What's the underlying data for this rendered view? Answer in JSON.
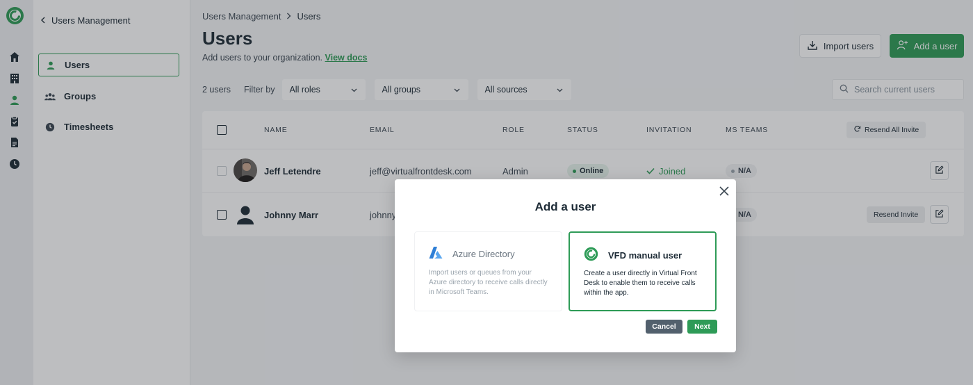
{
  "sidebar": {
    "back_label": "Users Management",
    "items": [
      {
        "label": "Users",
        "icon": "person-icon"
      },
      {
        "label": "Groups",
        "icon": "groups-icon"
      },
      {
        "label": "Timesheets",
        "icon": "clock-icon"
      }
    ]
  },
  "rail": {
    "icons": [
      "home-icon",
      "building-icon",
      "person-icon",
      "clipboard-check-icon",
      "document-icon",
      "clock-icon"
    ]
  },
  "header": {
    "breadcrumb": [
      "Users Management",
      "Users"
    ],
    "title": "Users",
    "subtitle": "Add users to your organization.",
    "docs_link": "View docs",
    "import_label": "Import users",
    "add_label": "Add a user"
  },
  "filters": {
    "count": "2 users",
    "filter_by": "Filter by",
    "roles": "All roles",
    "groups": "All groups",
    "sources": "All sources",
    "search_placeholder": "Search current users"
  },
  "table": {
    "columns": [
      "NAME",
      "EMAIL",
      "ROLE",
      "STATUS",
      "INVITATION",
      "MS TEAMS"
    ],
    "resend_all": "Resend All Invite",
    "rows": [
      {
        "name": "Jeff Letendre",
        "email": "jeff@virtualfrontdesk.com",
        "role": "Admin",
        "status": "Online",
        "invitation": "Joined",
        "ms_teams": "N/A"
      },
      {
        "name": "Johnny Marr",
        "email": "johnny",
        "role": "",
        "status": "",
        "invitation": "",
        "ms_teams": "N/A",
        "resend": "Resend Invite"
      }
    ]
  },
  "modal": {
    "title": "Add a user",
    "options": [
      {
        "title": "Azure Directory",
        "description": "Import users or queues from your Azure directory to receive calls directly in Microsoft Teams."
      },
      {
        "title": "VFD manual user",
        "description": "Create a user directly in Virtual Front Desk to enable them to receive calls within the app."
      }
    ],
    "cancel": "Cancel",
    "next": "Next"
  },
  "colors": {
    "brand": "#2e9b57",
    "text": "#1d2b36",
    "cancel": "#52606d"
  }
}
